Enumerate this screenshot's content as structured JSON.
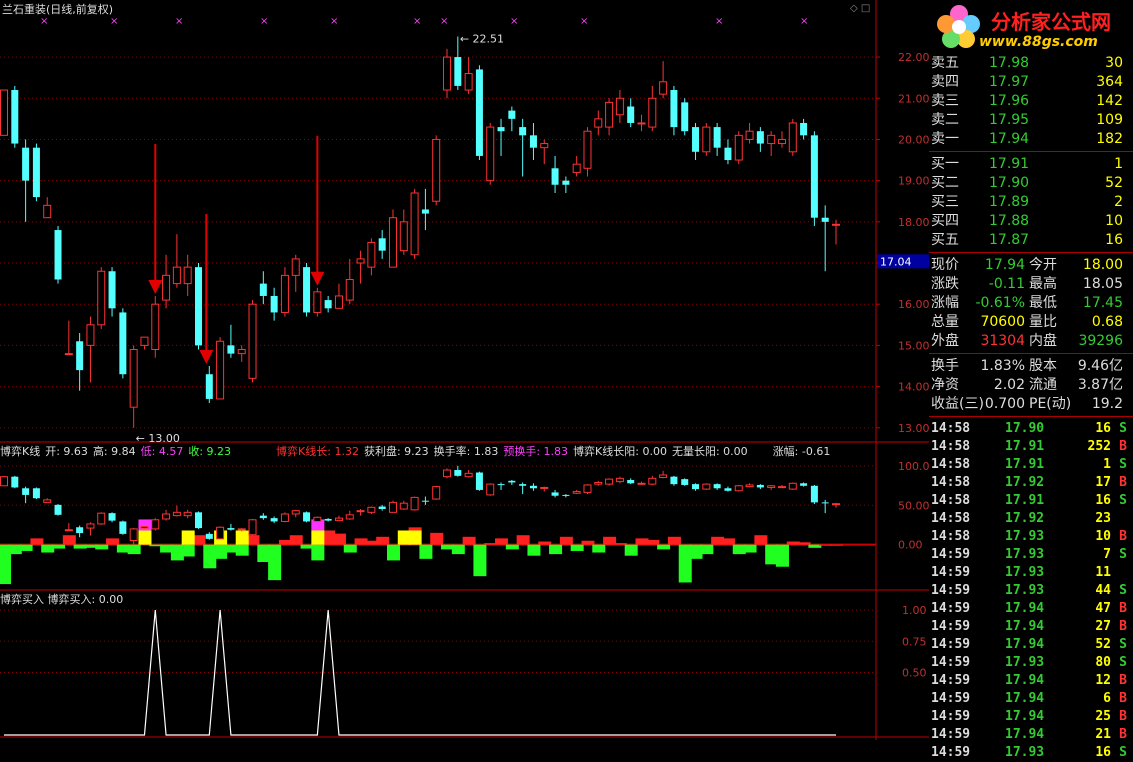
{
  "title": "兰石重装(日线,前复权)",
  "chart_data": {
    "type": "candlestick",
    "y_ticks": [
      "22.00",
      "21.00",
      "20.00",
      "19.00",
      "18.00",
      "17.00",
      "16.00",
      "15.00",
      "14.00",
      "13.00"
    ],
    "ylim": [
      12.8,
      22.9
    ],
    "high_label": "22.51",
    "low_label": "13.00",
    "last_price_tag": "17.04",
    "candles": [
      {
        "o": 20.1,
        "c": 21.2,
        "h": 21.2,
        "l": 20.1
      },
      {
        "o": 21.2,
        "c": 19.9,
        "h": 21.3,
        "l": 19.8
      },
      {
        "o": 19.8,
        "c": 19.0,
        "h": 20.0,
        "l": 18.0
      },
      {
        "o": 19.8,
        "c": 18.6,
        "h": 19.9,
        "l": 18.5
      },
      {
        "o": 18.1,
        "c": 18.4,
        "h": 18.6,
        "l": 18.1
      },
      {
        "o": 17.8,
        "c": 16.6,
        "h": 17.9,
        "l": 16.5
      },
      {
        "o": 14.8,
        "c": 14.8,
        "h": 15.6,
        "l": 14.8
      },
      {
        "o": 15.1,
        "c": 14.4,
        "h": 15.3,
        "l": 13.9
      },
      {
        "o": 15.0,
        "c": 15.5,
        "h": 15.7,
        "l": 14.1
      },
      {
        "o": 15.5,
        "c": 16.8,
        "h": 16.9,
        "l": 15.4
      },
      {
        "o": 16.8,
        "c": 15.9,
        "h": 16.9,
        "l": 15.7
      },
      {
        "o": 15.8,
        "c": 14.3,
        "h": 15.9,
        "l": 14.2
      },
      {
        "o": 13.5,
        "c": 14.9,
        "h": 15.0,
        "l": 13.0
      },
      {
        "o": 15.0,
        "c": 15.2,
        "h": 15.2,
        "l": 14.9
      },
      {
        "o": 14.9,
        "c": 16.0,
        "h": 16.2,
        "l": 14.7
      },
      {
        "o": 16.1,
        "c": 16.7,
        "h": 17.2,
        "l": 15.9
      },
      {
        "o": 16.5,
        "c": 16.9,
        "h": 17.7,
        "l": 16.4
      },
      {
        "o": 16.5,
        "c": 16.9,
        "h": 17.2,
        "l": 16.2
      },
      {
        "o": 16.9,
        "c": 15.0,
        "h": 17.0,
        "l": 14.9
      },
      {
        "o": 14.3,
        "c": 13.7,
        "h": 14.5,
        "l": 13.6
      },
      {
        "o": 13.7,
        "c": 15.1,
        "h": 15.2,
        "l": 13.7
      },
      {
        "o": 15.0,
        "c": 14.8,
        "h": 15.5,
        "l": 14.7
      },
      {
        "o": 14.8,
        "c": 14.9,
        "h": 15.0,
        "l": 14.6
      },
      {
        "o": 14.2,
        "c": 16.0,
        "h": 16.1,
        "l": 14.1
      },
      {
        "o": 16.5,
        "c": 16.2,
        "h": 16.8,
        "l": 16.0
      },
      {
        "o": 16.2,
        "c": 15.8,
        "h": 16.4,
        "l": 15.6
      },
      {
        "o": 15.8,
        "c": 16.7,
        "h": 16.9,
        "l": 15.7
      },
      {
        "o": 16.7,
        "c": 17.1,
        "h": 17.2,
        "l": 16.3
      },
      {
        "o": 16.9,
        "c": 15.8,
        "h": 17.0,
        "l": 15.7
      },
      {
        "o": 15.8,
        "c": 16.3,
        "h": 16.4,
        "l": 15.7
      },
      {
        "o": 16.1,
        "c": 15.9,
        "h": 16.2,
        "l": 15.8
      },
      {
        "o": 15.9,
        "c": 16.2,
        "h": 16.5,
        "l": 15.9
      },
      {
        "o": 16.1,
        "c": 16.6,
        "h": 17.1,
        "l": 16.0
      },
      {
        "o": 17.0,
        "c": 17.1,
        "h": 17.3,
        "l": 16.5
      },
      {
        "o": 16.9,
        "c": 17.5,
        "h": 17.6,
        "l": 16.7
      },
      {
        "o": 17.6,
        "c": 17.3,
        "h": 17.8,
        "l": 17.1
      },
      {
        "o": 16.9,
        "c": 18.1,
        "h": 18.3,
        "l": 16.9
      },
      {
        "o": 17.3,
        "c": 18.0,
        "h": 18.3,
        "l": 17.2
      },
      {
        "o": 17.2,
        "c": 18.7,
        "h": 18.8,
        "l": 17.1
      },
      {
        "o": 18.3,
        "c": 18.2,
        "h": 18.8,
        "l": 17.8
      },
      {
        "o": 18.5,
        "c": 20.0,
        "h": 20.1,
        "l": 18.4
      },
      {
        "o": 21.2,
        "c": 22.0,
        "h": 22.2,
        "l": 21.0
      },
      {
        "o": 22.0,
        "c": 21.3,
        "h": 22.5,
        "l": 21.2
      },
      {
        "o": 21.2,
        "c": 21.6,
        "h": 22.0,
        "l": 21.1
      },
      {
        "o": 21.7,
        "c": 19.6,
        "h": 21.8,
        "l": 19.5
      },
      {
        "o": 19.0,
        "c": 20.3,
        "h": 20.4,
        "l": 18.9
      },
      {
        "o": 20.3,
        "c": 20.2,
        "h": 20.5,
        "l": 19.6
      },
      {
        "o": 20.7,
        "c": 20.5,
        "h": 20.8,
        "l": 20.2
      },
      {
        "o": 20.3,
        "c": 20.1,
        "h": 20.5,
        "l": 19.1
      },
      {
        "o": 20.1,
        "c": 19.8,
        "h": 20.4,
        "l": 19.5
      },
      {
        "o": 19.8,
        "c": 19.9,
        "h": 20.0,
        "l": 19.4
      },
      {
        "o": 19.3,
        "c": 18.9,
        "h": 19.6,
        "l": 18.7
      },
      {
        "o": 19.0,
        "c": 18.9,
        "h": 19.1,
        "l": 18.7
      },
      {
        "o": 19.2,
        "c": 19.4,
        "h": 19.6,
        "l": 19.1
      },
      {
        "o": 19.3,
        "c": 20.2,
        "h": 20.3,
        "l": 19.1
      },
      {
        "o": 20.3,
        "c": 20.5,
        "h": 20.7,
        "l": 20.1
      },
      {
        "o": 20.3,
        "c": 20.9,
        "h": 21.0,
        "l": 20.1
      },
      {
        "o": 20.6,
        "c": 21.0,
        "h": 21.2,
        "l": 20.4
      },
      {
        "o": 20.8,
        "c": 20.4,
        "h": 21.0,
        "l": 20.3
      },
      {
        "o": 20.4,
        "c": 20.4,
        "h": 20.6,
        "l": 20.2
      },
      {
        "o": 20.3,
        "c": 21.0,
        "h": 21.3,
        "l": 20.2
      },
      {
        "o": 21.1,
        "c": 21.4,
        "h": 21.9,
        "l": 21.0
      },
      {
        "o": 21.2,
        "c": 20.3,
        "h": 21.3,
        "l": 20.1
      },
      {
        "o": 20.9,
        "c": 20.2,
        "h": 21.0,
        "l": 20.1
      },
      {
        "o": 20.3,
        "c": 19.7,
        "h": 20.4,
        "l": 19.5
      },
      {
        "o": 19.7,
        "c": 20.3,
        "h": 20.4,
        "l": 19.6
      },
      {
        "o": 20.3,
        "c": 19.8,
        "h": 20.4,
        "l": 19.6
      },
      {
        "o": 19.8,
        "c": 19.5,
        "h": 20.0,
        "l": 19.4
      },
      {
        "o": 19.5,
        "c": 20.1,
        "h": 20.2,
        "l": 19.4
      },
      {
        "o": 20.0,
        "c": 20.2,
        "h": 20.4,
        "l": 19.9
      },
      {
        "o": 20.2,
        "c": 19.9,
        "h": 20.3,
        "l": 19.7
      },
      {
        "o": 19.9,
        "c": 20.1,
        "h": 20.2,
        "l": 19.6
      },
      {
        "o": 19.9,
        "c": 20.0,
        "h": 20.2,
        "l": 19.8
      },
      {
        "o": 19.7,
        "c": 20.4,
        "h": 20.5,
        "l": 19.6
      },
      {
        "o": 20.4,
        "c": 20.1,
        "h": 20.5,
        "l": 20.0
      },
      {
        "o": 20.1,
        "c": 18.1,
        "h": 20.2,
        "l": 17.9
      },
      {
        "o": 18.1,
        "c": 18.0,
        "h": 18.4,
        "l": 16.8
      },
      {
        "o": 17.94,
        "c": 17.94,
        "h": 18.05,
        "l": 17.45
      }
    ],
    "arrow_candles": [
      14,
      19,
      29
    ],
    "sub1": {
      "header": [
        {
          "text": "博弈K线",
          "color": "#dddddd"
        },
        {
          "text": "开: 9.63",
          "color": "#dddddd"
        },
        {
          "text": "高: 9.84",
          "color": "#dddddd"
        },
        {
          "text": "低: 4.57",
          "color": "#ff40ff"
        },
        {
          "text": "收: 9.23",
          "color": "#40ff40"
        },
        {
          "text": "博弈K线长: 1.32",
          "color": "#ff3030"
        },
        {
          "text": "获利盘: 9.23",
          "color": "#dddddd"
        },
        {
          "text": "换手率: 1.83",
          "color": "#dddddd"
        },
        {
          "text": "预换手: 1.83",
          "color": "#ff40ff"
        },
        {
          "text": "博弈K线长阳: 0.00",
          "color": "#dddddd"
        },
        {
          "text": "无量长阳: 0.00",
          "color": "#dddddd"
        },
        {
          "text": "涨幅: -0.61",
          "color": "#dddddd"
        }
      ],
      "y_ticks": [
        "100.0",
        "50.00",
        "0.00"
      ],
      "ylim": [
        -55,
        110
      ],
      "bars": [
        -50,
        -12,
        -8,
        8,
        -10,
        -5,
        12,
        -5,
        -4,
        -6,
        8,
        -10,
        -12,
        10,
        -2,
        -10,
        -20,
        -15,
        12,
        -30,
        -18,
        -10,
        -14,
        12,
        -22,
        -45,
        6,
        12,
        -5,
        -20,
        18,
        14,
        -10,
        8,
        5,
        10,
        -20,
        6,
        22,
        -18,
        15,
        -6,
        -12,
        10,
        -40,
        2,
        8,
        -6,
        12,
        -14,
        4,
        -12,
        10,
        -8,
        5,
        -10,
        10,
        2,
        -14,
        8,
        6,
        -6,
        10,
        -48,
        -18,
        -12,
        10,
        8,
        -12,
        -10,
        12,
        -25,
        -28,
        4,
        3,
        -4,
        0,
        0
      ],
      "yellow": [
        13,
        17,
        20,
        22,
        29,
        37,
        38
      ],
      "magenta": [
        13,
        29
      ]
    },
    "sub2": {
      "header": "博弈买入  博弈买入: 0.00",
      "y_ticks": [
        "1.00",
        "0.75",
        "0.50"
      ],
      "signals": [
        14,
        20,
        30
      ]
    }
  },
  "quote": {
    "asks": [
      {
        "label": "卖五",
        "price": "17.98",
        "vol": "30"
      },
      {
        "label": "卖四",
        "price": "17.97",
        "vol": "364"
      },
      {
        "label": "卖三",
        "price": "17.96",
        "vol": "142"
      },
      {
        "label": "卖二",
        "price": "17.95",
        "vol": "109"
      },
      {
        "label": "卖一",
        "price": "17.94",
        "vol": "182"
      }
    ],
    "bids": [
      {
        "label": "买一",
        "price": "17.91",
        "vol": "1"
      },
      {
        "label": "买二",
        "price": "17.90",
        "vol": "52"
      },
      {
        "label": "买三",
        "price": "17.89",
        "vol": "2"
      },
      {
        "label": "买四",
        "price": "17.88",
        "vol": "10"
      },
      {
        "label": "买五",
        "price": "17.87",
        "vol": "16"
      }
    ],
    "stats": [
      {
        "l1": "现价",
        "v1": "17.94",
        "c1": "g",
        "l2": "今开",
        "v2": "18.00",
        "c2": "y"
      },
      {
        "l1": "涨跌",
        "v1": "-0.11",
        "c1": "g",
        "l2": "最高",
        "v2": "18.05",
        "c2": "w"
      },
      {
        "l1": "涨幅",
        "v1": "-0.61%",
        "c1": "g",
        "l2": "最低",
        "v2": "17.45",
        "c2": "g"
      },
      {
        "l1": "总量",
        "v1": "70600",
        "c1": "y",
        "l2": "量比",
        "v2": "0.68",
        "c2": "y"
      },
      {
        "l1": "外盘",
        "v1": "31304",
        "c1": "r",
        "l2": "内盘",
        "v2": "39296",
        "c2": "g"
      }
    ],
    "fund": [
      {
        "l1": "换手",
        "v1": "1.83%",
        "l2": "股本",
        "v2": "9.46亿"
      },
      {
        "l1": "净资",
        "v1": "2.02",
        "l2": "流通",
        "v2": "3.87亿"
      },
      {
        "l1": "收益(三)",
        "v1": "0.700",
        "l2": "PE(动)",
        "v2": "19.2"
      }
    ],
    "trades": [
      {
        "t": "14:58",
        "p": "17.90",
        "v": "16",
        "s": "S"
      },
      {
        "t": "14:58",
        "p": "17.91",
        "v": "252",
        "s": "B"
      },
      {
        "t": "14:58",
        "p": "17.91",
        "v": "1",
        "s": "S"
      },
      {
        "t": "14:58",
        "p": "17.92",
        "v": "17",
        "s": "B"
      },
      {
        "t": "14:58",
        "p": "17.91",
        "v": "16",
        "s": "S"
      },
      {
        "t": "14:58",
        "p": "17.92",
        "v": "23",
        "s": ""
      },
      {
        "t": "14:58",
        "p": "17.93",
        "v": "10",
        "s": "B"
      },
      {
        "t": "14:59",
        "p": "17.93",
        "v": "7",
        "s": "S"
      },
      {
        "t": "14:59",
        "p": "17.93",
        "v": "11",
        "s": ""
      },
      {
        "t": "14:59",
        "p": "17.93",
        "v": "44",
        "s": "S"
      },
      {
        "t": "14:59",
        "p": "17.94",
        "v": "47",
        "s": "B"
      },
      {
        "t": "14:59",
        "p": "17.94",
        "v": "27",
        "s": "B"
      },
      {
        "t": "14:59",
        "p": "17.94",
        "v": "52",
        "s": "S"
      },
      {
        "t": "14:59",
        "p": "17.93",
        "v": "80",
        "s": "S"
      },
      {
        "t": "14:59",
        "p": "17.94",
        "v": "12",
        "s": "B"
      },
      {
        "t": "14:59",
        "p": "17.94",
        "v": "6",
        "s": "B"
      },
      {
        "t": "14:59",
        "p": "17.94",
        "v": "25",
        "s": "B"
      },
      {
        "t": "14:59",
        "p": "17.94",
        "v": "21",
        "s": "B"
      },
      {
        "t": "14:59",
        "p": "17.93",
        "v": "16",
        "s": "S"
      }
    ]
  },
  "logo": {
    "brand": "分析家公式网",
    "url": "www.88gs.com"
  },
  "colors": {
    "up": "#ff3232",
    "down": "#54ffff",
    "grid": "#8c0000",
    "axis": "#c00000",
    "arrow": "#e00000"
  }
}
